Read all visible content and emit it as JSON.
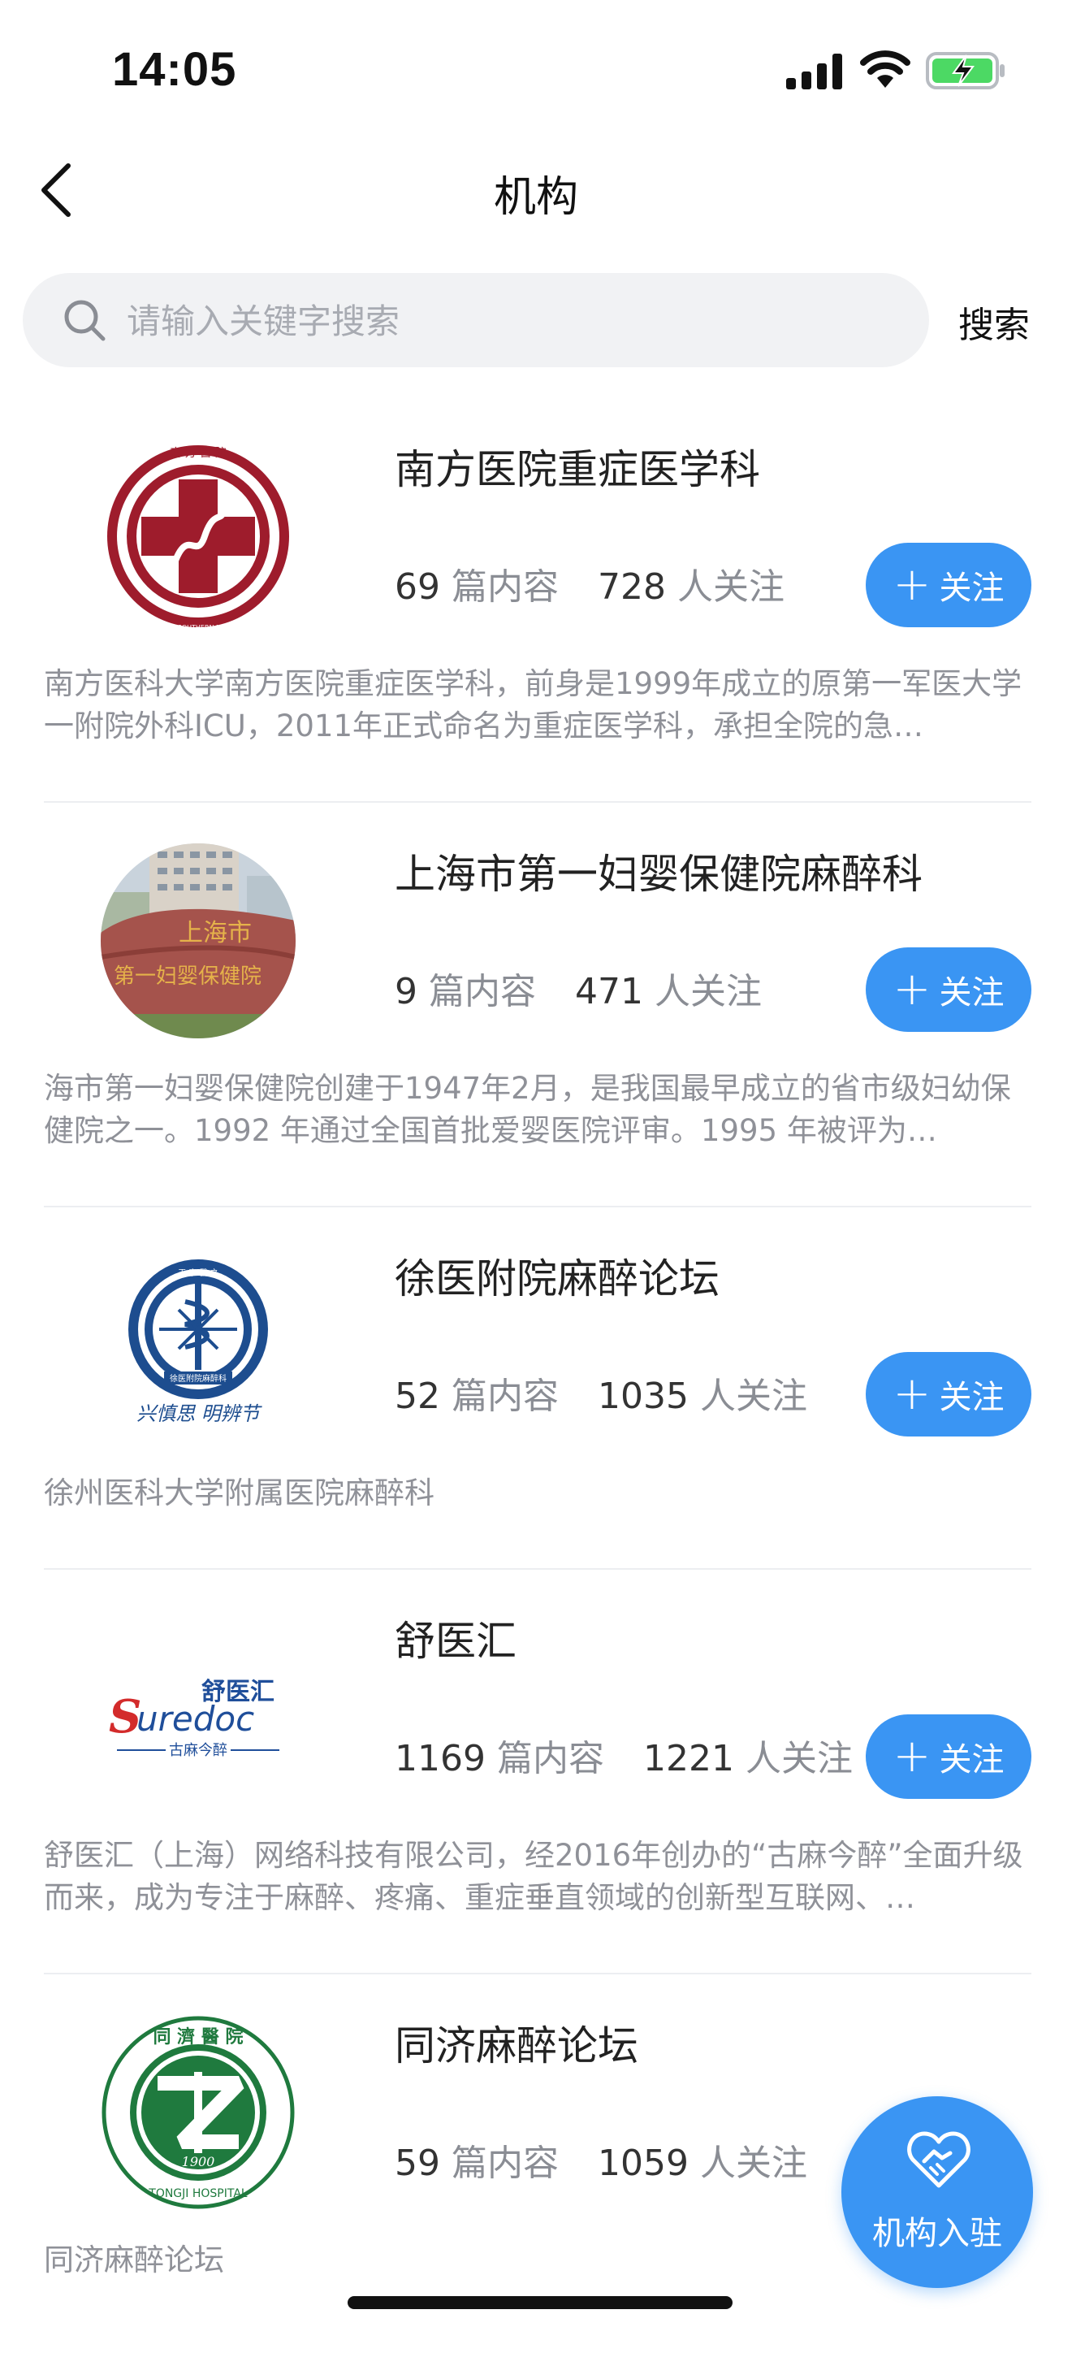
{
  "status_bar": {
    "time": "14:05"
  },
  "nav": {
    "title": "机构"
  },
  "search": {
    "placeholder": "请输入关键字搜索",
    "button_label": "搜索"
  },
  "follow_label": "关注",
  "institutions": [
    {
      "name": "南方医院重症医学科",
      "posts": "69",
      "posts_unit": "篇内容",
      "followers": "728",
      "followers_unit": "人关注",
      "description": "南方医科大学南方医院重症医学科，前身是1999年成立的原第一军医大学一附院外科ICU，2011年正式命名为重症医学科，承担全院的急…",
      "logo": "red-cross-hospital-logo"
    },
    {
      "name": "上海市第一妇婴保健院麻醉科",
      "posts": "9",
      "posts_unit": "篇内容",
      "followers": "471",
      "followers_unit": "人关注",
      "description": "海市第一妇婴保健院创建于1947年2月，是我国最早成立的省市级妇幼保健院之一。1992 年通过全国首批爱婴医院评审。1995 年被评为…",
      "logo": "hospital-stone-photo"
    },
    {
      "name": "徐医附院麻醉论坛",
      "posts": "52",
      "posts_unit": "篇内容",
      "followers": "1035",
      "followers_unit": "人关注",
      "description": "徐州医科大学附属医院麻醉科",
      "logo": "medical-emblem-logo"
    },
    {
      "name": "舒医汇",
      "posts": "1169",
      "posts_unit": "篇内容",
      "followers": "1221",
      "followers_unit": "人关注",
      "description": "舒医汇（上海）网络科技有限公司，经2016年创办的“古麻今醉”全面升级而来，成为专注于麻醉、疼痛、重症垂直领域的创新型互联网、…",
      "logo": "suredoc-logo"
    },
    {
      "name": "同济麻醉论坛",
      "posts": "59",
      "posts_unit": "篇内容",
      "followers": "1059",
      "followers_unit": "人关注",
      "description": "同济麻醉论坛",
      "logo": "tongji-hospital-logo"
    }
  ],
  "logos": {
    "inst1": {
      "arc_text": "南 方 醫 院",
      "ring_text": "NANFANG HOSPITAL SOUTHERN MEDICAL UNIVERSITY"
    },
    "inst2": {
      "stone_text_1": "上海市",
      "stone_text_2": "第一妇婴保健院"
    },
    "inst3": {
      "motto": "兴慎思 明辨节",
      "top_text": "王 字 醫 之",
      "band_text": "徐医附院麻醉科"
    },
    "inst4": {
      "cn_text": "舒医汇",
      "brand_red": "S",
      "brand_blue": "uredoc",
      "sub_text": "古麻今醉"
    },
    "inst5": {
      "cn_text": "同 濟 醫 院",
      "year": "1900",
      "en_text": "TONGJI HOSPITAL"
    }
  },
  "float_button": {
    "label": "机构入驻"
  },
  "colors": {
    "accent": "#3a95f3",
    "text_muted": "#8f9198"
  }
}
